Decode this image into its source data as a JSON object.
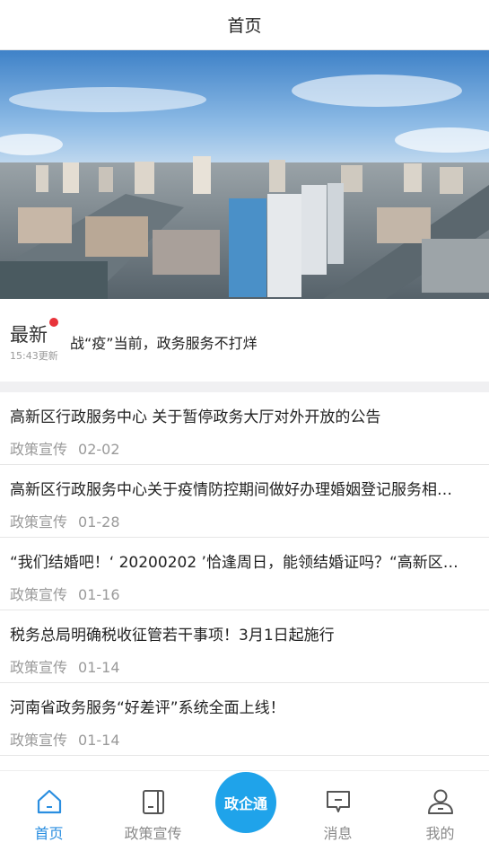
{
  "header": {
    "title": "首页"
  },
  "latest": {
    "label": "最新",
    "update_time": "15:43更新",
    "headline": "战“疫”当前，政务服务不打烊"
  },
  "news": [
    {
      "title": "高新区行政服务中心 关于暂停政务大厅对外开放的公告",
      "category": "政策宣传",
      "date": "02-02"
    },
    {
      "title": "高新区行政服务中心关于疫情防控期间做好办理婚姻登记服务相…",
      "category": "政策宣传",
      "date": "01-28"
    },
    {
      "title": "“我们结婚吧！‘ 20200202 ’恰逢周日，能领结婚证吗？“高新区…",
      "category": "政策宣传",
      "date": "01-16"
    },
    {
      "title": "税务总局明确税收征管若干事项！3月1日起施行",
      "category": "政策宣传",
      "date": "01-14"
    },
    {
      "title": "河南省政务服务“好差评”系统全面上线！",
      "category": "政策宣传",
      "date": "01-14"
    }
  ],
  "tabbar": {
    "home": "首页",
    "policy": "政策宣传",
    "center": "政企通",
    "messages": "消息",
    "mine": "我的"
  },
  "colors": {
    "accent": "#2a8ee0",
    "center_button": "#1fa3ea",
    "badge": "#e8333a"
  }
}
